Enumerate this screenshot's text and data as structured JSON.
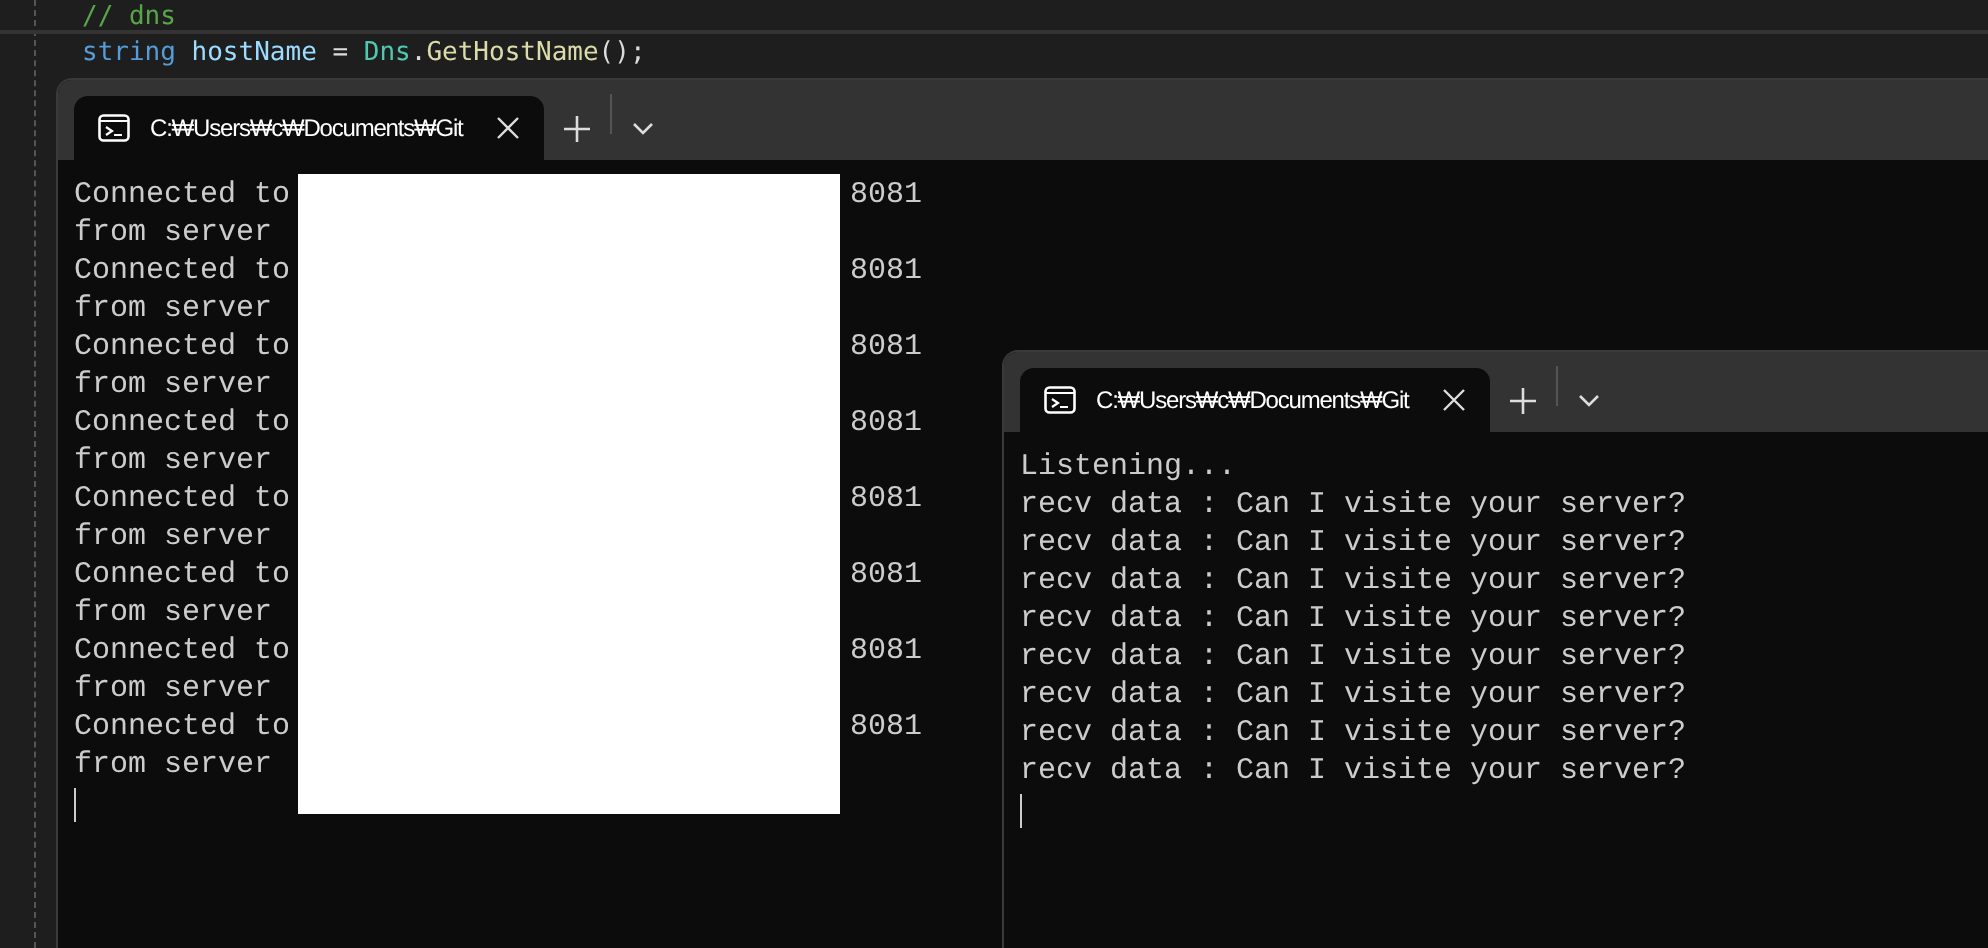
{
  "editor": {
    "lines": [
      [
        {
          "text": "// dns",
          "kind": "comment"
        }
      ],
      [
        {
          "text": "string",
          "kind": "keyword"
        },
        {
          "text": "hostName",
          "kind": "variable"
        },
        {
          "text": " = ",
          "kind": "plain"
        },
        {
          "text": "Dns",
          "kind": "type"
        },
        {
          "text": ".",
          "kind": "plain"
        },
        {
          "text": "GetHostName",
          "kind": "method"
        },
        {
          "text": "();",
          "kind": "plain"
        }
      ]
    ]
  },
  "terminals": [
    {
      "tab": {
        "title": "C:₩Users₩c₩Documents₩Git",
        "selected": true
      },
      "redacted": true,
      "lines": [
        {
          "text": "Connected to",
          "tail": "8081"
        },
        {
          "text": "from server"
        },
        {
          "text": "Connected to",
          "tail": "8081"
        },
        {
          "text": "from server"
        },
        {
          "text": "Connected to",
          "tail": "8081"
        },
        {
          "text": "from server"
        },
        {
          "text": "Connected to",
          "tail": "8081"
        },
        {
          "text": "from server"
        },
        {
          "text": "Connected to",
          "tail": "8081"
        },
        {
          "text": "from server"
        },
        {
          "text": "Connected to",
          "tail": "8081"
        },
        {
          "text": "from server"
        },
        {
          "text": "Connected to",
          "tail": "8081"
        },
        {
          "text": "from server"
        },
        {
          "text": "Connected to",
          "tail": "8081"
        },
        {
          "text": "from server"
        }
      ]
    },
    {
      "tab": {
        "title": "C:₩Users₩c₩Documents₩Git",
        "selected": true
      },
      "redacted": false,
      "lines": [
        {
          "text": "Listening..."
        },
        {
          "text": "recv data : Can I visite your server?"
        },
        {
          "text": "recv data : Can I visite your server?"
        },
        {
          "text": "recv data : Can I visite your server?"
        },
        {
          "text": "recv data : Can I visite your server?"
        },
        {
          "text": "recv data : Can I visite your server?"
        },
        {
          "text": "recv data : Can I visite your server?"
        },
        {
          "text": "recv data : Can I visite your server?"
        },
        {
          "text": "recv data : Can I visite your server?"
        }
      ]
    }
  ]
}
